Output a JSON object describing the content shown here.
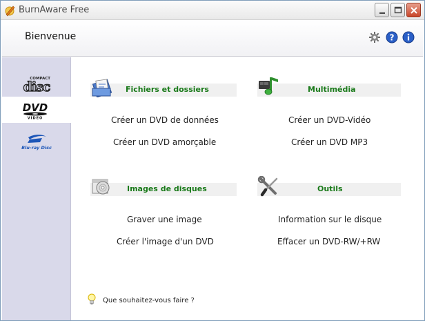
{
  "window": {
    "title": "BurnAware Free",
    "controls": {
      "minimize": "minimize",
      "maximize": "maximize",
      "close": "close"
    }
  },
  "header": {
    "title": "Bienvenue",
    "icons": [
      "gear-icon",
      "help-icon",
      "info-icon"
    ]
  },
  "sidebar": {
    "items": [
      {
        "id": "cd",
        "label": "COMPACT disc",
        "icon": "compact-disc-logo",
        "active": false
      },
      {
        "id": "dvd",
        "label": "DVD VIDEO",
        "icon": "dvd-video-logo",
        "active": true
      },
      {
        "id": "bluray",
        "label": "Blu-ray Disc",
        "icon": "blu-ray-logo",
        "active": false
      }
    ]
  },
  "sections": {
    "files": {
      "title": "Fichiers et dossiers",
      "icon": "files-folders-icon",
      "actions": [
        "Créer un DVD de données",
        "Créer un DVD amorçable"
      ]
    },
    "multimedia": {
      "title": "Multimédia",
      "icon": "music-note-icon",
      "actions": [
        "Créer un DVD-Vidéo",
        "Créer un DVD MP3"
      ]
    },
    "images": {
      "title": "Images de disques",
      "icon": "disc-image-icon",
      "actions": [
        "Graver une image",
        "Créer l'image d'un DVD"
      ]
    },
    "tools": {
      "title": "Outils",
      "icon": "tools-icon",
      "actions": [
        "Information sur le disque",
        "Effacer un DVD-RW/+RW"
      ]
    }
  },
  "footer": {
    "hint": "Que souhaitez-vous faire ?",
    "icon": "lightbulb-icon"
  },
  "colors": {
    "accent_green": "#1a7a1a",
    "sidebar_bg": "#d9d9ea",
    "section_bg": "#f0f0f0",
    "close_red": "#c8462a"
  }
}
